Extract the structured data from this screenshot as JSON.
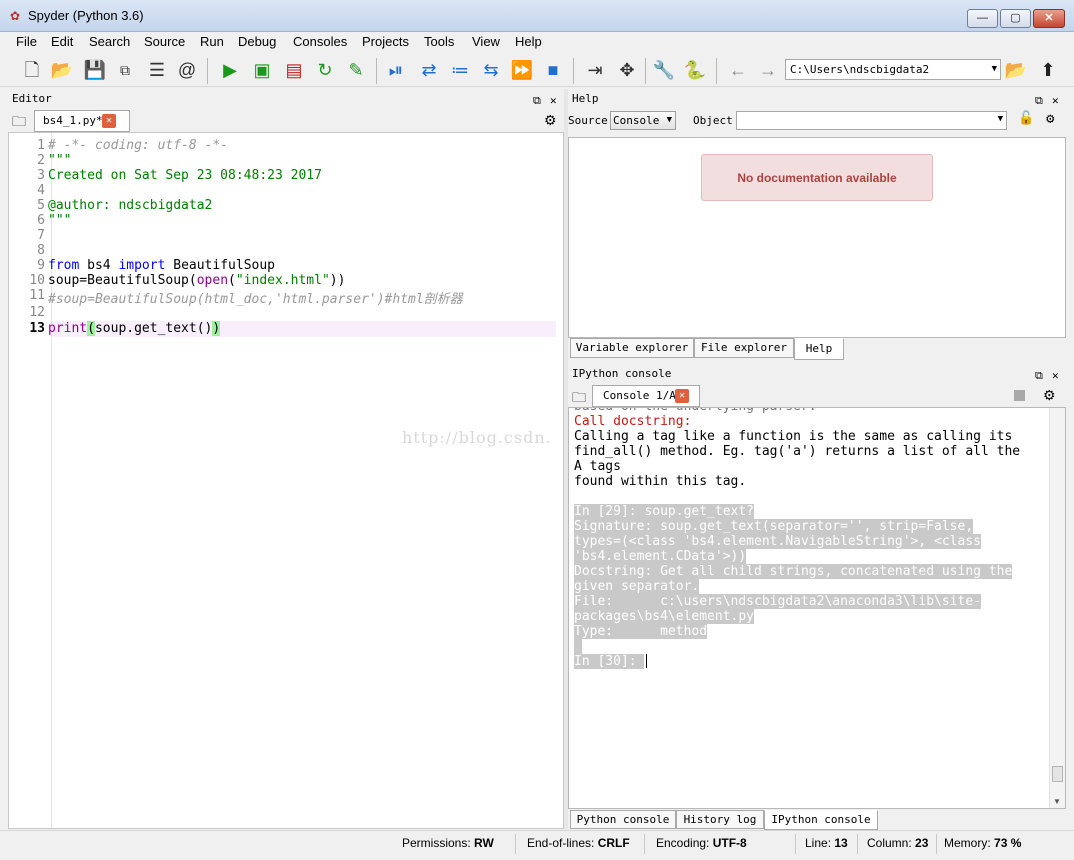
{
  "window": {
    "title": "Spyder (Python 3.6)",
    "min": "—",
    "max": "▢",
    "close": "✕"
  },
  "menu": [
    "File",
    "Edit",
    "Search",
    "Source",
    "Run",
    "Debug",
    "Consoles",
    "Projects",
    "Tools",
    "View",
    "Help"
  ],
  "toolbar": {
    "path": "C:\\Users\\ndscbigdata2"
  },
  "editor": {
    "pane_title": "Editor",
    "tab_label": "bs4_1.py*",
    "lines": [
      {
        "n": "1",
        "text": "# -*- coding: utf-8 -*-"
      },
      {
        "n": "2",
        "text": "\"\"\""
      },
      {
        "n": "3",
        "text": "Created on Sat Sep 23 08:48:23 2017"
      },
      {
        "n": "4",
        "text": ""
      },
      {
        "n": "5",
        "text": "@author: ndscbigdata2"
      },
      {
        "n": "6",
        "text": "\"\"\""
      },
      {
        "n": "7",
        "text": ""
      },
      {
        "n": "8",
        "text": ""
      },
      {
        "n": "9",
        "text": "from bs4 import BeautifulSoup"
      },
      {
        "n": "10",
        "text": "soup=BeautifulSoup(open(\"index.html\"))"
      },
      {
        "n": "11",
        "text": "#soup=BeautifulSoup(html_doc,'html.parser')#html剖析器"
      },
      {
        "n": "12",
        "text": ""
      },
      {
        "n": "13",
        "text": "print(soup.get_text())"
      }
    ]
  },
  "help": {
    "pane_title": "Help",
    "source_label": "Source",
    "source_value": "Console",
    "object_label": "Object",
    "message": "No documentation available",
    "tabs": [
      "Variable explorer",
      "File explorer",
      "Help"
    ]
  },
  "console": {
    "pane_title": "IPython console",
    "tab_label": "Console 1/A",
    "lines": [
      "Call docstring:",
      "Calling a tag like a function is the same as calling its",
      "find_all() method. Eg. tag('a') returns a list of all the",
      "A tags",
      "found within this tag.",
      "",
      "In [29]: soup.get_text?",
      "Signature: soup.get_text(separator='', strip=False,",
      "types=(<class 'bs4.element.NavigableString'>, <class",
      "'bs4.element.CData'>))",
      "Docstring: Get all child strings, concatenated using the",
      "given separator.",
      "File:      c:\\users\\ndscbigdata2\\anaconda3\\lib\\site-",
      "packages\\bs4\\element.py",
      "Type:      method",
      "",
      "In [30]: "
    ],
    "tabs": [
      "Python console",
      "History log",
      "IPython console"
    ]
  },
  "watermark": "http://blog.csdn.",
  "status": {
    "permissions_label": "Permissions:",
    "permissions": "RW",
    "eol_label": "End-of-lines:",
    "eol": "CRLF",
    "encoding_label": "Encoding:",
    "encoding": "UTF-8",
    "line_label": "Line:",
    "line": "13",
    "column_label": "Column:",
    "column": "23",
    "memory_label": "Memory:",
    "memory": "73 %"
  },
  "colors": {
    "comment": "#999999",
    "string": "#008000",
    "keyword": "#0000ff",
    "error": "#c41a16"
  }
}
